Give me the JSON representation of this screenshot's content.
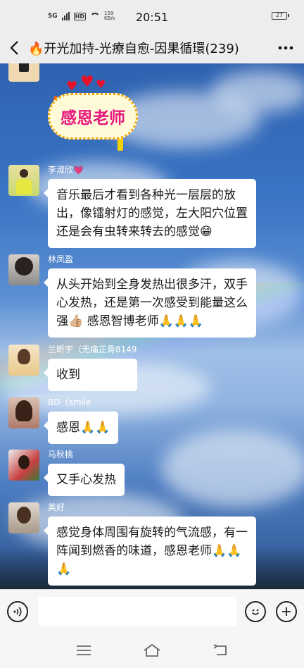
{
  "status_bar": {
    "network": "5G",
    "hd": "HD",
    "speed_value": "159",
    "speed_unit": "KB/s",
    "time": "20:51",
    "battery": "27"
  },
  "header": {
    "back_icon": "chevron-left-icon",
    "title_emoji": "🔥",
    "title": "开光加持-光療自愈-因果循環(239)",
    "more_icon": "more-horizontal-icon"
  },
  "sticker": {
    "text": "感恩老师"
  },
  "messages": [
    {
      "sender": "李淑欣💗",
      "text": "音乐最后才看到各种光一层层的放出，像镭射灯的感觉，左大阳穴位置还是会有虫转来转去的感觉😁"
    },
    {
      "sender": "林凤盈",
      "text": "从头开始到全身发热出很多汗，双手心发热，还是第一次感受到能量这么强👍🏼 感恩智博老师🙏🙏🙏"
    },
    {
      "sender": "兰昕宇（无痛正骨8149",
      "text": "收到"
    },
    {
      "sender": "BD（smile",
      "text": "感恩🙏🙏"
    },
    {
      "sender": "马秋桃",
      "text": "又手心发热"
    },
    {
      "sender": "美好",
      "text": "感觉身体周围有旋转的气流感，有一阵闻到燃香的味道，感恩老师🙏🙏🙏"
    }
  ],
  "input_bar": {
    "voice_icon": "voice-icon",
    "emoji_icon": "emoji-icon",
    "plus_icon": "plus-icon"
  },
  "system_nav": {
    "menu_icon": "menu-icon",
    "home_icon": "home-icon",
    "back_icon": "back-icon"
  },
  "colors": {
    "bubble": "#ffffff",
    "chrome": "#ededed",
    "sticker_text": "#e8177f"
  }
}
